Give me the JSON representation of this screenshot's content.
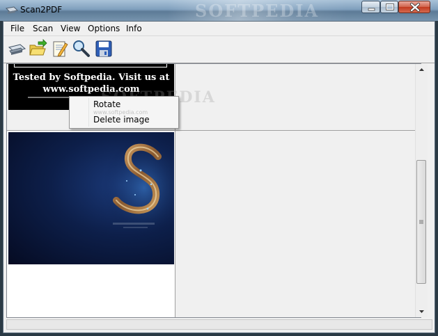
{
  "window": {
    "title": "Scan2PDF",
    "watermark": "SOFTPEDIA",
    "controls": {
      "minimize": "minimize-icon",
      "maximize": "maximize-icon",
      "close": "close-icon"
    }
  },
  "menu": [
    "File",
    "Scan",
    "View",
    "Options",
    "Info"
  ],
  "toolbar": {
    "buttons": [
      {
        "icon": "scanner-icon"
      },
      {
        "icon": "open-folder-icon"
      },
      {
        "icon": "edit-document-icon"
      },
      {
        "icon": "magnifier-icon"
      },
      {
        "icon": "save-disk-icon"
      }
    ]
  },
  "thumbnails": [
    {
      "line1": "Tested by Softpedia. Visit us at",
      "line2": "www.softpedia.com"
    },
    {
      "image": "softpedia-logo-dark-blue"
    }
  ],
  "context_menu": {
    "items": [
      "Rotate",
      "Delete image"
    ],
    "watermark": "www.softpedia.com"
  },
  "colors": {
    "accent": "#1b3a7a",
    "menu_bg": "#f0f0f0",
    "close_red": "#c23a1f"
  }
}
